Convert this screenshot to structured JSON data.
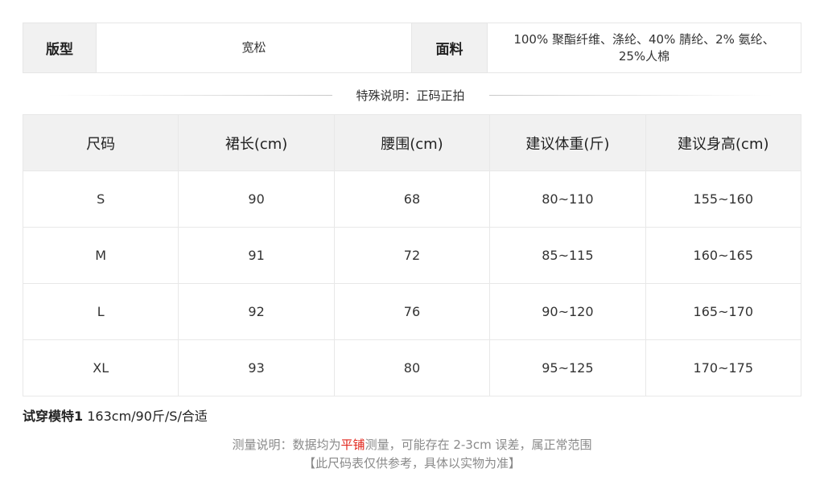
{
  "info": {
    "fit_label": "版型",
    "fit_value": "宽松",
    "fabric_label": "面料",
    "fabric_line1": "100% 聚酯纤维、涤纶、40% 腈纶、2% 氨纶、",
    "fabric_line2": "25%人棉"
  },
  "special_note": "特殊说明：正码正拍",
  "size_table": {
    "headers": [
      "尺码",
      "裙长(cm)",
      "腰围(cm)",
      "建议体重(斤)",
      "建议身高(cm)"
    ],
    "rows": [
      [
        "S",
        "90",
        "68",
        "80~110",
        "155~160"
      ],
      [
        "M",
        "91",
        "72",
        "85~115",
        "160~165"
      ],
      [
        "L",
        "92",
        "76",
        "90~120",
        "165~170"
      ],
      [
        "XL",
        "93",
        "80",
        "95~125",
        "170~175"
      ]
    ]
  },
  "model_note": {
    "label": "试穿模特1",
    "value": " 163cm/90斤/S/合适"
  },
  "footer": {
    "line1_pre": "测量说明：数据均为",
    "line1_highlight": "平铺",
    "line1_post": "测量，可能存在 2-3cm 误差，属正常范围",
    "line2": "【此尺码表仅供参考，具体以实物为准】",
    "highlight_color": "#e1251b"
  }
}
